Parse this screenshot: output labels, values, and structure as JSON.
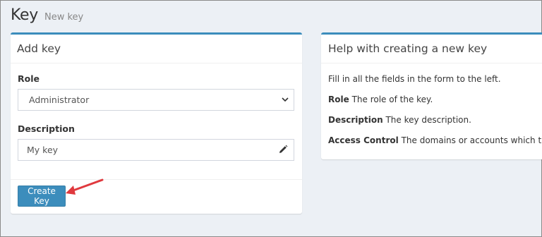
{
  "header": {
    "title": "Key",
    "subtitle": "New key"
  },
  "add_box": {
    "title": "Add key",
    "role_label": "Role",
    "role_value": "Administrator",
    "description_label": "Description",
    "description_value": "My key",
    "submit_label": "Create Key"
  },
  "help_box": {
    "title": "Help with creating a new key",
    "intro": "Fill in all the fields in the form to the left.",
    "items": [
      {
        "term": "Role",
        "text": "The role of the key."
      },
      {
        "term": "Description",
        "text": "The key description."
      },
      {
        "term": "Access Control",
        "text": "The domains or accounts which the ke"
      }
    ]
  },
  "colors": {
    "accent": "#3c8dbc",
    "background": "#ecf0f5",
    "annotation_arrow": "#e0393e"
  }
}
